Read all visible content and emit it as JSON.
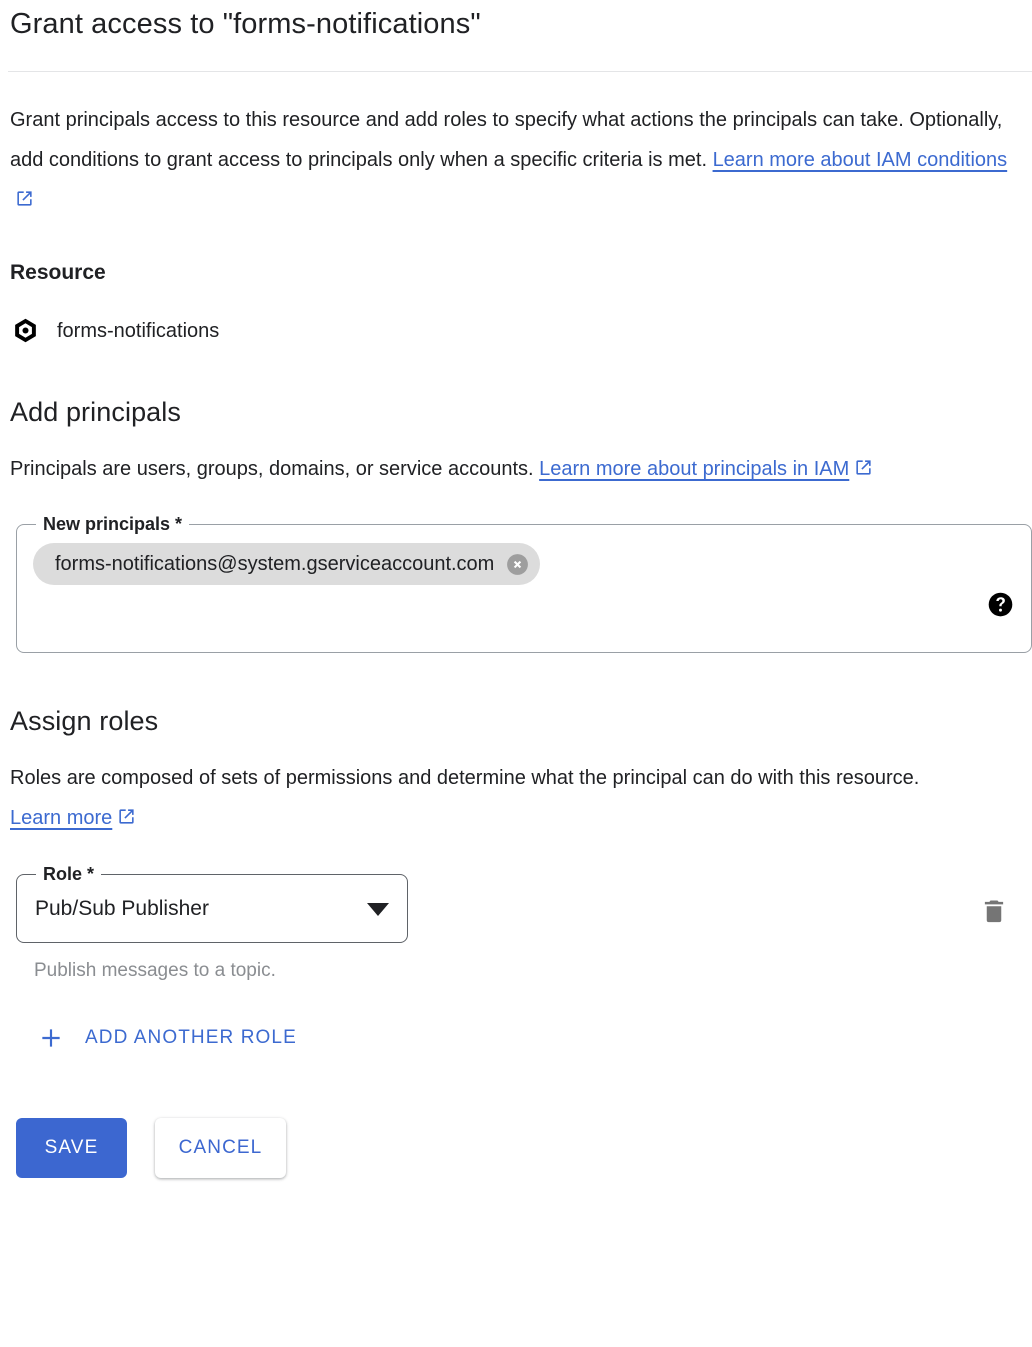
{
  "dialog": {
    "title": "Grant access to \"forms-notifications\"",
    "intro_text_part1": "Grant principals access to this resource and add roles to specify what actions the principals can take. Optionally, add conditions to grant access to principals only when a specific criteria is met. ",
    "intro_link_label": "Learn more about IAM conditions"
  },
  "resource": {
    "heading": "Resource",
    "icon": "pubsub-topic-icon",
    "name": "forms-notifications"
  },
  "add_principals": {
    "heading": "Add principals",
    "description_part1": "Principals are users, groups, domains, or service accounts. ",
    "description_link_label": "Learn more about principals in IAM",
    "field_label": "New principals *",
    "chips": [
      {
        "label": "forms-notifications@system.gserviceaccount.com",
        "remove_icon": "cancel-icon"
      }
    ],
    "input_placeholder": "",
    "help_icon": "help-icon"
  },
  "assign_roles": {
    "heading": "Assign roles",
    "description_part1": "Roles are composed of sets of permissions and determine what the principal can do with this resource. ",
    "description_link_label": "Learn more",
    "role_field_label": "Role *",
    "role_value": "Pub/Sub Publisher",
    "role_helper_text": "Publish messages to a topic.",
    "delete_icon": "trash-icon",
    "dropdown_icon": "chevron-down-icon",
    "add_another_role_label": "ADD ANOTHER ROLE",
    "add_icon": "plus-icon"
  },
  "footer": {
    "save_label": "SAVE",
    "cancel_label": "CANCEL"
  },
  "colors": {
    "accent_blue": "#3c67d0",
    "link_blue": "#3c6ad0",
    "text_primary": "#202124",
    "text_secondary": "#8a8d91",
    "chip_bg": "#dcdcdc",
    "border": "#9aa0a6",
    "divider": "#e4e5e7"
  }
}
